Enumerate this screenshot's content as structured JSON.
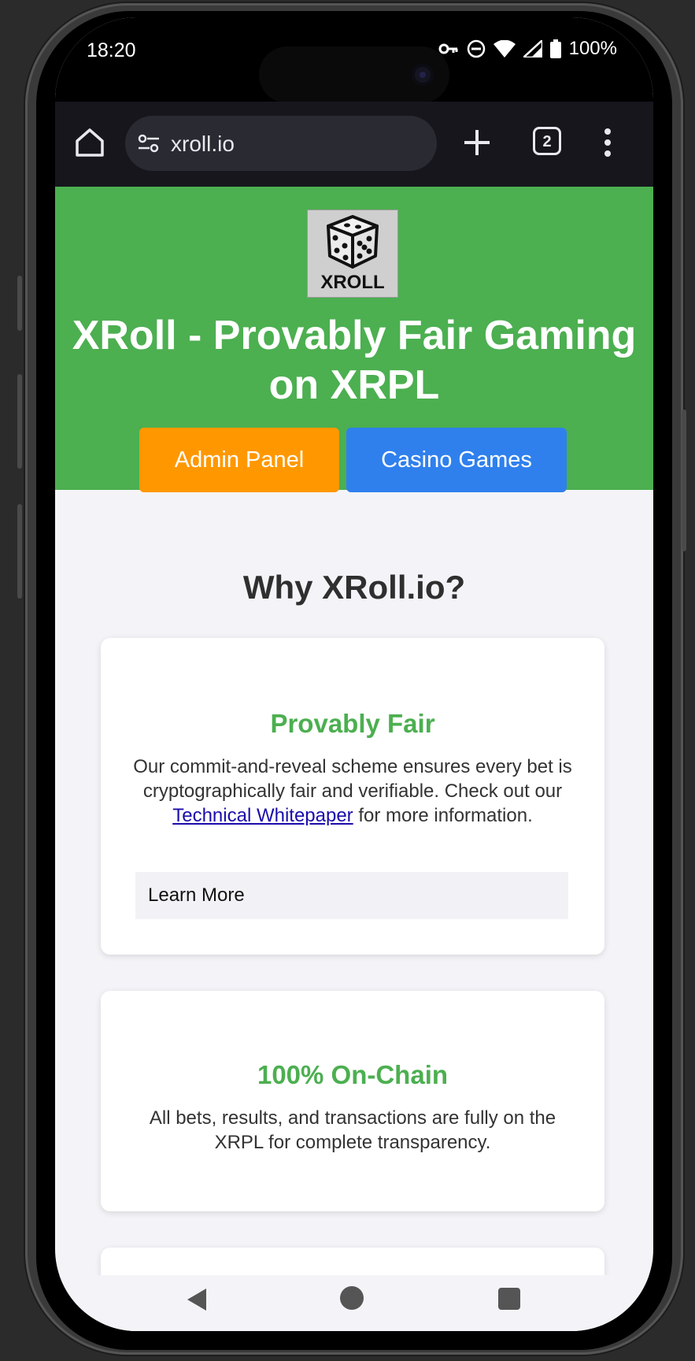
{
  "status_bar": {
    "time": "18:20",
    "battery": "100%",
    "icons": [
      "vpn-key-icon",
      "do-not-disturb-icon",
      "wifi-icon",
      "signal-icon",
      "battery-icon"
    ]
  },
  "browser": {
    "url": "xroll.io",
    "tab_count": "2",
    "icons": [
      "home-icon",
      "site-settings-icon",
      "plus-icon",
      "tabs-icon",
      "more-vert-icon"
    ]
  },
  "header": {
    "logo_text": "XROLL",
    "title": "XRoll - Provably Fair Gaming on XRPL",
    "buttons": {
      "admin": "Admin Panel",
      "casino": "Casino Games"
    },
    "colors": {
      "header_bg": "#4caf50",
      "admin_btn": "#ff9800",
      "casino_btn": "#2f80ed"
    }
  },
  "main": {
    "section_title": "Why XRoll.io?",
    "cards": [
      {
        "title": "Provably Fair",
        "text_before_link": "Our commit-and-reveal scheme ensures every bet is cryptographically fair and verifiable. Check out our ",
        "link_text": "Technical Whitepaper",
        "text_after_link": " for more information.",
        "button": "Learn More"
      },
      {
        "title": "100% On-Chain",
        "text": "All bets, results, and transactions are fully on the XRPL for complete transparency."
      }
    ],
    "accent_color": "#4caf50"
  },
  "nav_bar": {
    "icons": [
      "back-icon",
      "home-circle-icon",
      "recents-icon"
    ]
  }
}
